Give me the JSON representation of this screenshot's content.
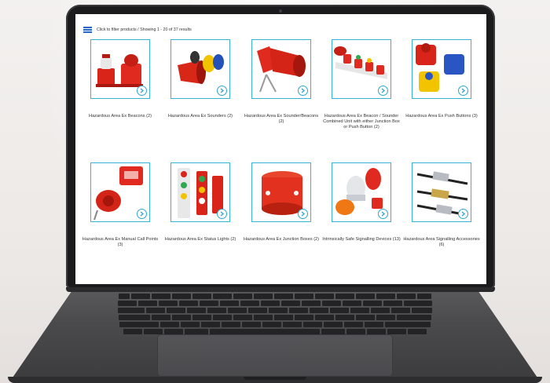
{
  "toolbar": {
    "filter_link": "Click to filter products",
    "separator": "/",
    "results_text": "Showing 1 - 20 of 37 results"
  },
  "products": [
    {
      "label": "Hazardous Area Ex Beacons (2)",
      "icon": "beacon"
    },
    {
      "label": "Hazardous Area Ex Sounders (2)",
      "icon": "sounder"
    },
    {
      "label": "Hazardous Area Ex Sounder/Beacons (2)",
      "icon": "sounder-beacon"
    },
    {
      "label": "Hazardous Area Ex Beacon / Sounder Combined Unit with either Junction Box or Push Button (2)",
      "icon": "combined-unit"
    },
    {
      "label": "Hazardous Area Ex Push Buttons (3)",
      "icon": "push-buttons"
    },
    {
      "label": "Hazardous Area Ex Manual Call Points (3)",
      "icon": "call-point"
    },
    {
      "label": "Hazardous Area Ex Status Lights (2)",
      "icon": "status-lights"
    },
    {
      "label": "Hazardous Area Ex Junction Boxes (2)",
      "icon": "junction-box"
    },
    {
      "label": "Intrinsically Safe Signalling Devices (13)",
      "icon": "is-devices"
    },
    {
      "label": "Hazardous Area Signalling Accessories (6)",
      "icon": "cable-glands"
    }
  ],
  "colors": {
    "accent": "#37b3d9",
    "menu": "#2d66c9",
    "product_red": "#e1261c"
  }
}
